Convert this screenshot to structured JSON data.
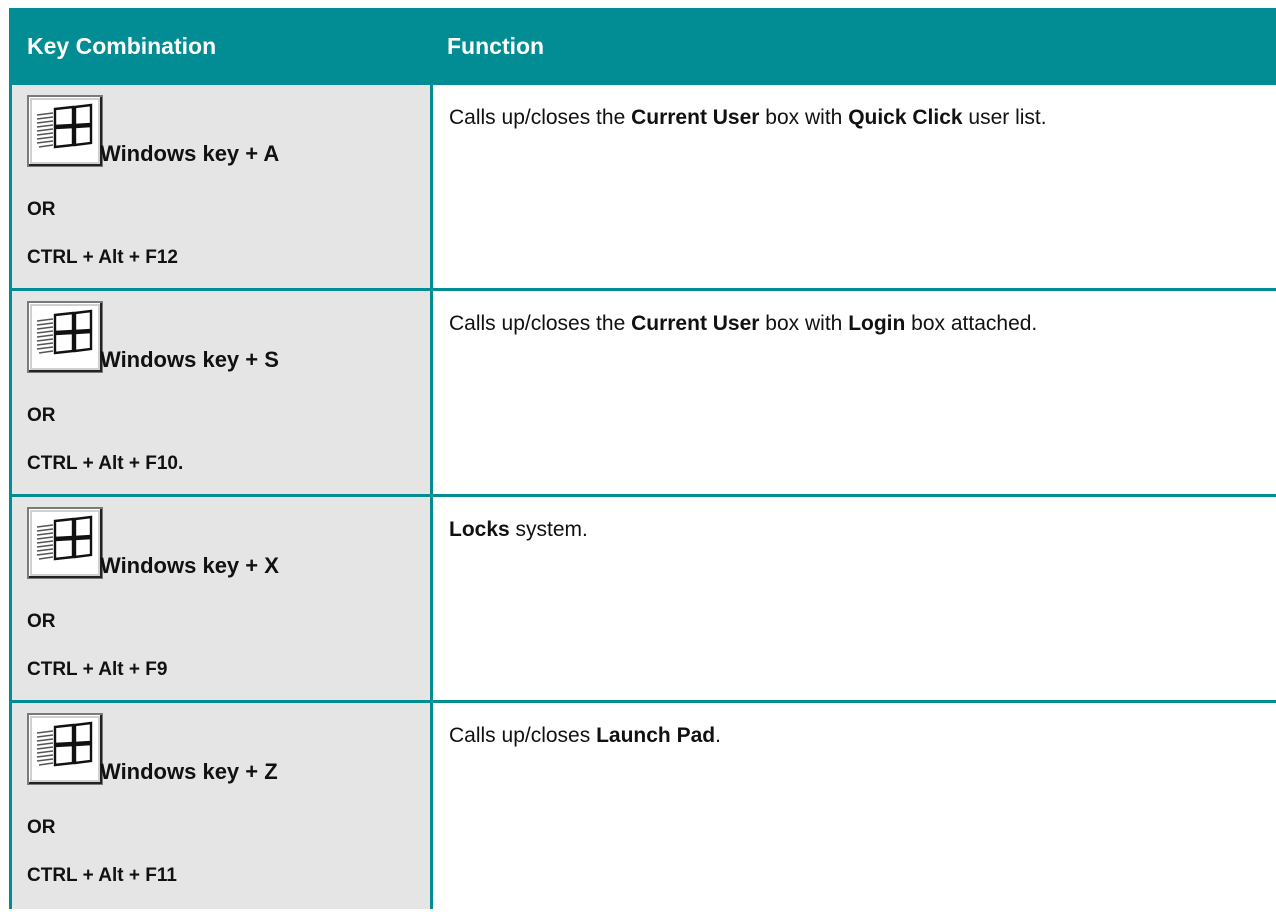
{
  "header": {
    "col1": "Key Combination",
    "col2": "Function"
  },
  "colors": {
    "accent": "#028d95",
    "left_cell_bg": "#e5e5e5"
  },
  "rows": [
    {
      "icon": "windows-key-icon",
      "combo": "Windows key + A",
      "or": "OR",
      "alt": "CTRL + Alt + F12",
      "func": [
        {
          "t": "Calls up/closes the ",
          "b": false
        },
        {
          "t": "Current User",
          "b": true
        },
        {
          "t": " box with ",
          "b": false
        },
        {
          "t": "Quick Click",
          "b": true
        },
        {
          "t": " user list.",
          "b": false
        }
      ]
    },
    {
      "icon": "windows-key-icon",
      "combo": "Windows key + S",
      "or": "OR",
      "alt": "CTRL + Alt + F10.",
      "func": [
        {
          "t": "Calls up/closes the ",
          "b": false
        },
        {
          "t": "Current User",
          "b": true
        },
        {
          "t": " box with ",
          "b": false
        },
        {
          "t": "Login",
          "b": true
        },
        {
          "t": " box attached.",
          "b": false
        }
      ]
    },
    {
      "icon": "windows-key-icon",
      "combo": "Windows key + X",
      "or": "OR",
      "alt": "CTRL + Alt + F9",
      "func": [
        {
          "t": "Locks",
          "b": true
        },
        {
          "t": " system.",
          "b": false
        }
      ]
    },
    {
      "icon": "windows-key-icon",
      "combo": "Windows key + Z",
      "or": "OR",
      "alt": "CTRL + Alt + F11",
      "func": [
        {
          "t": "Calls up/closes ",
          "b": false
        },
        {
          "t": "Launch Pad",
          "b": true
        },
        {
          "t": ".",
          "b": false
        }
      ]
    }
  ]
}
